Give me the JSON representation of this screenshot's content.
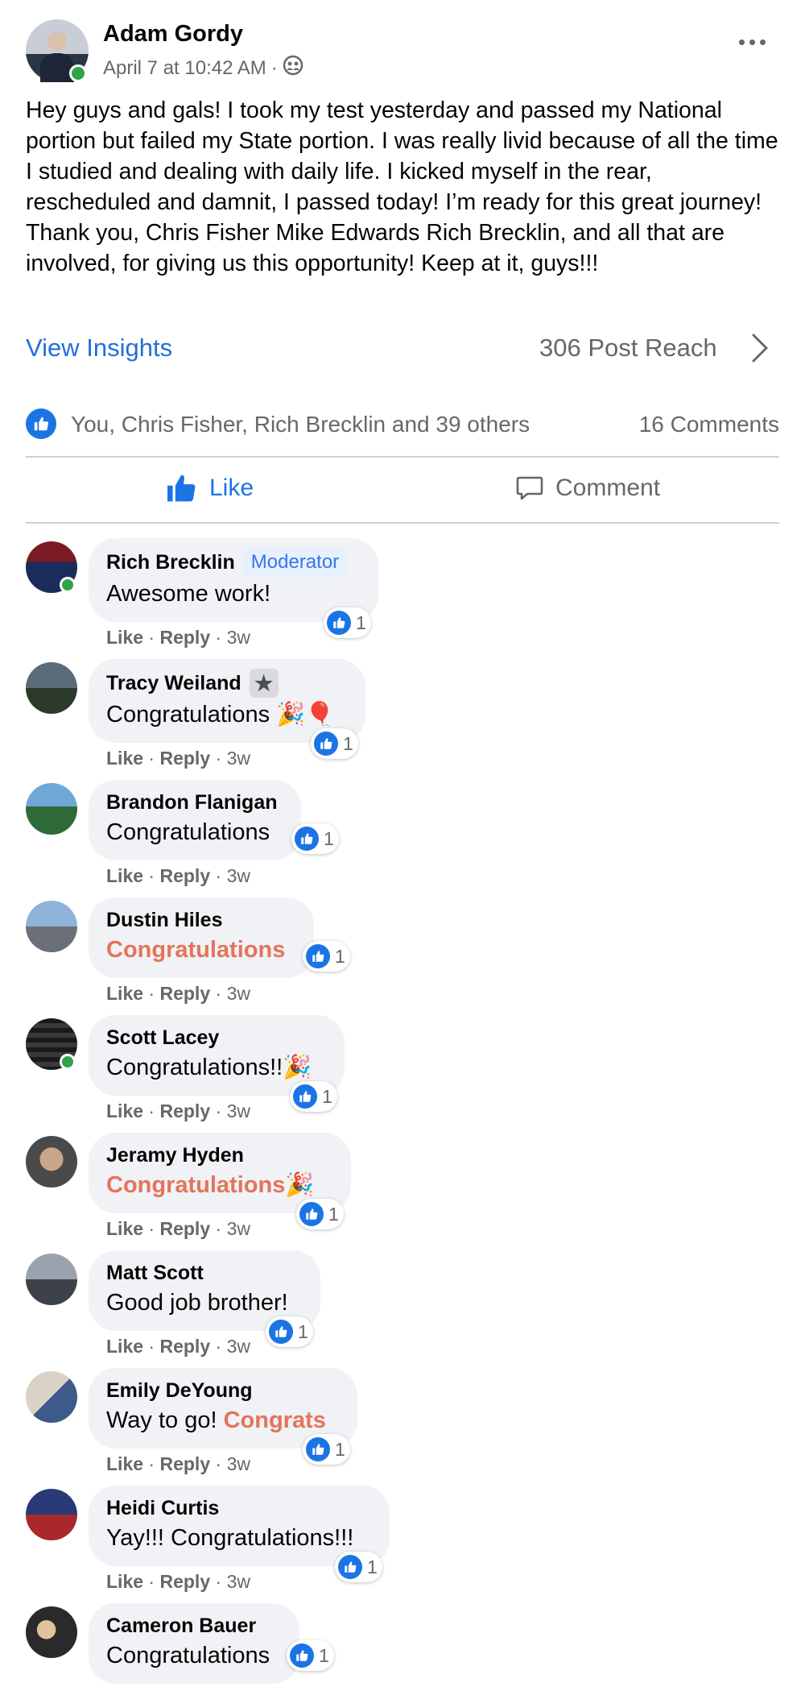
{
  "post": {
    "author": "Adam Gordy",
    "timestamp": "April 7 at 10:42 AM",
    "meta_separator": "·",
    "audience_icon": "group-icon",
    "body": "Hey guys and gals! I took my test yesterday and passed my National portion but failed my State portion. I was really livid because of all the time I studied and dealing with daily life. I kicked myself in the rear, rescheduled and damnit, I passed today! I’m ready for this great journey! Thank you, Chris Fisher Mike Edwards Rich Brecklin, and all that are involved, for giving us this opportunity! Keep at it, guys!!!",
    "insights_label": "View Insights",
    "reach_label": "306 Post Reach",
    "reactions_summary": "You, Chris Fisher, Rich Brecklin and 39 others",
    "comments_count": "16 Comments",
    "like_label": "Like",
    "comment_label": "Comment",
    "colors": {
      "accent": "#1b74e4",
      "muted": "#65676b",
      "highlight": "#e4745a",
      "online": "#31a24c"
    }
  },
  "comment_actions": {
    "like": "Like",
    "reply": "Reply",
    "sep": "·"
  },
  "comments": [
    {
      "name": "Rich Brecklin",
      "badge": "Moderator",
      "pre": "Awesome work!",
      "hl": "",
      "emoji": "",
      "time": "3w",
      "reactions": "1"
    },
    {
      "name": "Tracy Weiland",
      "badge_icon": "star-icon",
      "pre": "Congratulations ",
      "hl": "",
      "emoji": "🎉🎈",
      "time": "3w",
      "reactions": "1"
    },
    {
      "name": "Brandon Flanigan",
      "pre": "Congratulations",
      "hl": "",
      "emoji": "",
      "time": "3w",
      "reactions": "1"
    },
    {
      "name": "Dustin Hiles",
      "pre": "",
      "hl": "Congratulations",
      "emoji": "",
      "time": "3w",
      "reactions": "1"
    },
    {
      "name": "Scott Lacey",
      "pre": "Congratulations!!",
      "hl": "",
      "emoji": "🎉",
      "time": "3w",
      "reactions": "1"
    },
    {
      "name": "Jeramy Hyden",
      "pre": "",
      "hl": "Congratulations",
      "emoji": " 🎉",
      "time": "3w",
      "reactions": "1"
    },
    {
      "name": "Matt Scott",
      "pre": "Good job brother!",
      "hl": "",
      "emoji": "",
      "time": "3w",
      "reactions": "1"
    },
    {
      "name": "Emily DeYoung",
      "pre": "Way to go! ",
      "hl": "Congrats",
      "emoji": "",
      "time": "3w",
      "reactions": "1"
    },
    {
      "name": "Heidi Curtis",
      "pre": "Yay!!! Congratulations!!!",
      "hl": "",
      "emoji": "",
      "time": "3w",
      "reactions": "1"
    },
    {
      "name": "Cameron Bauer",
      "pre": "Congratulations",
      "hl": "",
      "emoji": "",
      "time": "",
      "reactions": "1"
    }
  ]
}
